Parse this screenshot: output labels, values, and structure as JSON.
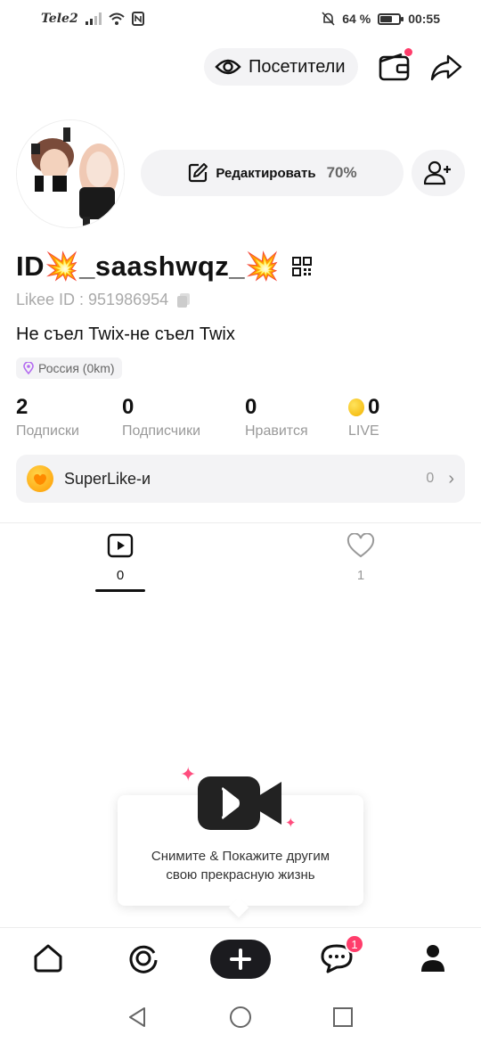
{
  "status_bar": {
    "carrier": "Tele2",
    "battery": "64 %",
    "battery_level": 0.64,
    "time": "00:55"
  },
  "header": {
    "visitors_label": "Посетители",
    "wallet_icon": "wallet-icon",
    "share_icon": "share-icon"
  },
  "profile": {
    "edit_label": "Редактировать",
    "edit_percent": "70%",
    "username": "ID💥_saashwqz_💥",
    "likee_id": "Likee ID : 951986954",
    "bio": "Не съел Twix-не съел Twix",
    "location": "Россия (0km)"
  },
  "stats": [
    {
      "value": "2",
      "label": "Подписки"
    },
    {
      "value": "0",
      "label": "Подписчики"
    },
    {
      "value": "0",
      "label": "Нравится"
    },
    {
      "value": "0",
      "label": "LIVE"
    }
  ],
  "superlike": {
    "label": "SuperLike-и",
    "count": "0"
  },
  "tabs": [
    {
      "icon": "video-icon",
      "count": "0",
      "active": true
    },
    {
      "icon": "heart-icon",
      "count": "1",
      "active": false
    }
  ],
  "empty_state": {
    "line1": "Снимите & Покажите другим",
    "line2": "свою прекрасную жизнь"
  },
  "bottom_nav": {
    "items": [
      "home-icon",
      "explore-icon",
      "create-icon",
      "messages-icon",
      "profile-icon"
    ],
    "messages_badge": "1"
  },
  "colors": {
    "accent": "#ff3d6b",
    "pill_bg": "#f3f3f5",
    "dark": "#1b1b1f"
  }
}
